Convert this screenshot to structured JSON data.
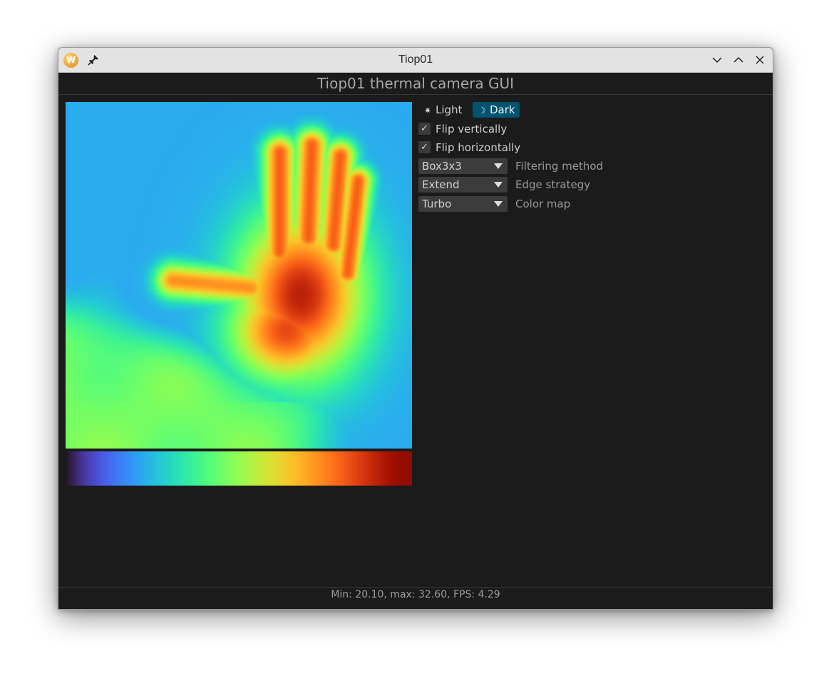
{
  "window": {
    "title": "Tiop01",
    "app_icon_letter": "W",
    "icons": [
      "app-icon",
      "pin-icon",
      "minimize-icon",
      "maximize-icon",
      "close-icon"
    ]
  },
  "heading": "Tiop01 thermal camera GUI",
  "theme": {
    "light_label": "Light",
    "dark_label": "Dark",
    "light_icon": "sun-icon",
    "dark_icon": "moon-icon",
    "selected": "Dark"
  },
  "checkboxes": [
    {
      "label": "Flip vertically",
      "checked": true
    },
    {
      "label": "Flip horizontally",
      "checked": true
    }
  ],
  "combos": [
    {
      "value": "Box3x3",
      "label": "Filtering method"
    },
    {
      "value": "Extend",
      "label": "Edge strategy"
    },
    {
      "value": "Turbo",
      "label": "Color map"
    }
  ],
  "colors": {
    "selected_theme_bg": "#00536e",
    "window_bg": "#1b1b1b",
    "colormap_stops": [
      "#30123b",
      "#4686fb",
      "#1ae4b6",
      "#a2fc3c",
      "#fabb39",
      "#e4460a",
      "#7a0403"
    ]
  },
  "readings": {
    "min": 20.1,
    "max": 32.6,
    "fps": 4.29
  },
  "status_text": "Min: 20.10, max: 32.60, FPS: 4.29"
}
